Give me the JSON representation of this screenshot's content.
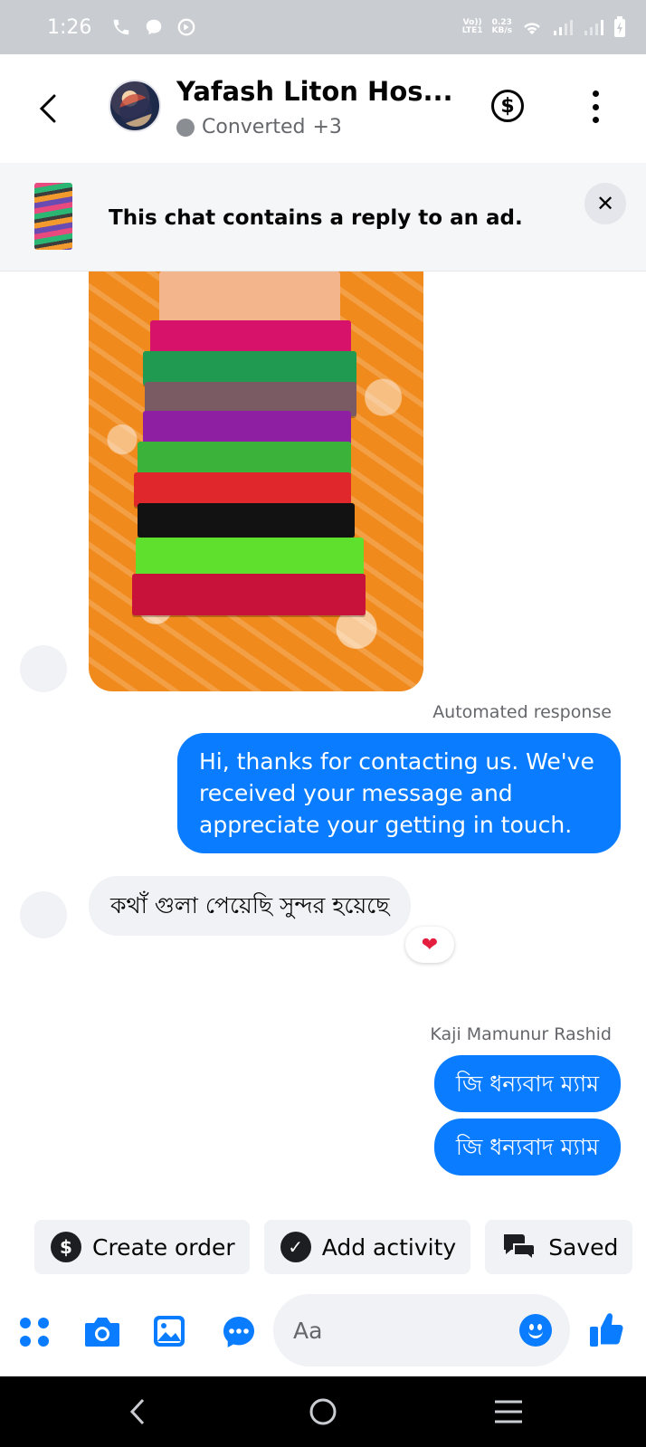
{
  "status_bar": {
    "time": "1:26",
    "network_top": "Vo))",
    "network_bottom": "LTE1",
    "speed_top": "0.23",
    "speed_bottom": "KB/s"
  },
  "header": {
    "title": "Yafash Liton Hos...",
    "status": "Converted",
    "extra": "+3"
  },
  "ad_banner": {
    "text": "This chat contains a reply to an ad."
  },
  "messages": {
    "automated_label": "Automated response",
    "automated_text": "Hi, thanks for contacting us. We've received your message and appreciate your getting in touch.",
    "incoming_text": "কথাঁ গুলা পেয়েছি সুন্দর হয়েছে",
    "incoming_reaction": "❤",
    "sender_label": "Kaji Mamunur Rashid",
    "outgoing_1": "জি ধন্যবাদ ম্যাম",
    "outgoing_2": "জি ধন্যবাদ ম্যাম"
  },
  "quick_actions": {
    "create_order": "Create order",
    "add_activity": "Add activity",
    "saved": "Saved"
  },
  "composer": {
    "placeholder": "Aa"
  },
  "colors": {
    "accent": "#0a7cff",
    "status_bar": "#c9ccd1",
    "bubble_in": "#f0f2f5"
  }
}
